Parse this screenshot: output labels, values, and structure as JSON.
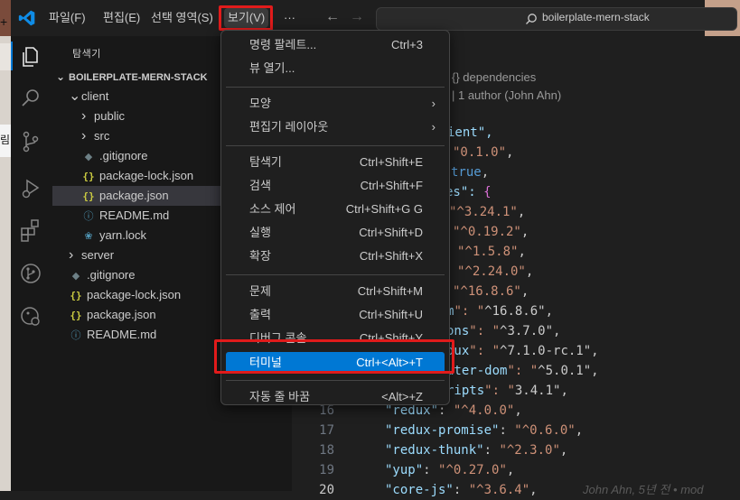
{
  "menubar": {
    "items": [
      "파일(F)",
      "편집(E)",
      "선택 영역(S)",
      "보기(V)",
      "···"
    ],
    "active": "보기(V)"
  },
  "command_center": {
    "text": "boilerplate-mern-stack"
  },
  "sidebar": {
    "title": "탐색기",
    "section": "BOILERPLATE-MERN-STACK",
    "items": [
      {
        "label": "client",
        "type": "folder-open"
      },
      {
        "label": "public",
        "type": "folder"
      },
      {
        "label": "src",
        "type": "folder"
      },
      {
        "label": ".gitignore",
        "type": "git"
      },
      {
        "label": "package-lock.json",
        "type": "json"
      },
      {
        "label": "package.json",
        "type": "json",
        "selected": true
      },
      {
        "label": "README.md",
        "type": "md"
      },
      {
        "label": "yarn.lock",
        "type": "yarn"
      },
      {
        "label": "server",
        "type": "folder"
      },
      {
        "label": ".gitignore",
        "type": "git"
      },
      {
        "label": "package-lock.json",
        "type": "json"
      },
      {
        "label": "package.json",
        "type": "json"
      },
      {
        "label": "README.md",
        "type": "md"
      }
    ]
  },
  "editor": {
    "breadcrumb": "{} dependencies",
    "codelens": "| 1 author (John Ahn)",
    "code_fragments": [
      "ient\",",
      "\"0.1.0\",",
      "true,",
      "es\": {",
      "\"^3.24.1\",",
      "\"^0.19.2\",",
      "\"^1.5.8\",",
      "\"^2.24.0\",",
      "\"^16.8.6\",",
      "m\": \"^16.8.6\",",
      "ons\": \"^3.7.0\",",
      "dux\": \"^7.1.0-rc.1\",",
      "uter-dom\": \"^5.0.1\",",
      "ripts\": \"3.4.1\","
    ],
    "full_lines": [
      {
        "num": "16",
        "key": "\"redux\"",
        "val": "\"^4.0.0\""
      },
      {
        "num": "17",
        "key": "\"redux-promise\"",
        "val": "\"^0.6.0\""
      },
      {
        "num": "18",
        "key": "\"redux-thunk\"",
        "val": "\"^2.3.0\""
      },
      {
        "num": "19",
        "key": "\"yup\"",
        "val": "\"^0.27.0\""
      },
      {
        "num": "20",
        "key": "\"core-js\"",
        "val": "\"^3.6.4\""
      }
    ],
    "blame": "John Ahn, 5년 전 • mod"
  },
  "view_menu": {
    "groups": [
      [
        {
          "label": "명령 팔레트...",
          "shortcut": "Ctrl+3"
        },
        {
          "label": "뷰 열기...",
          "shortcut": ""
        }
      ],
      [
        {
          "label": "모양",
          "shortcut": "",
          "submenu": true
        },
        {
          "label": "편집기 레이아웃",
          "shortcut": "",
          "submenu": true
        }
      ],
      [
        {
          "label": "탐색기",
          "shortcut": "Ctrl+Shift+E"
        },
        {
          "label": "검색",
          "shortcut": "Ctrl+Shift+F"
        },
        {
          "label": "소스 제어",
          "shortcut": "Ctrl+Shift+G G"
        },
        {
          "label": "실행",
          "shortcut": "Ctrl+Shift+D"
        },
        {
          "label": "확장",
          "shortcut": "Ctrl+Shift+X"
        }
      ],
      [
        {
          "label": "문제",
          "shortcut": "Ctrl+Shift+M"
        },
        {
          "label": "출력",
          "shortcut": "Ctrl+Shift+U"
        },
        {
          "label": "디버그 콘솔",
          "shortcut": "Ctrl+Shift+Y"
        },
        {
          "label": "터미널",
          "shortcut": "Ctrl+<Alt>+T",
          "active": true
        }
      ],
      [
        {
          "label": "자동 줄 바꿈",
          "shortcut": "<Alt>+Z"
        }
      ]
    ]
  },
  "outer": {
    "plus": "+",
    "fragment": "림"
  },
  "colors": {
    "accent": "#0078d4",
    "annotation": "#e11b1b",
    "string": "#ce9178",
    "key": "#9cdcfe"
  }
}
